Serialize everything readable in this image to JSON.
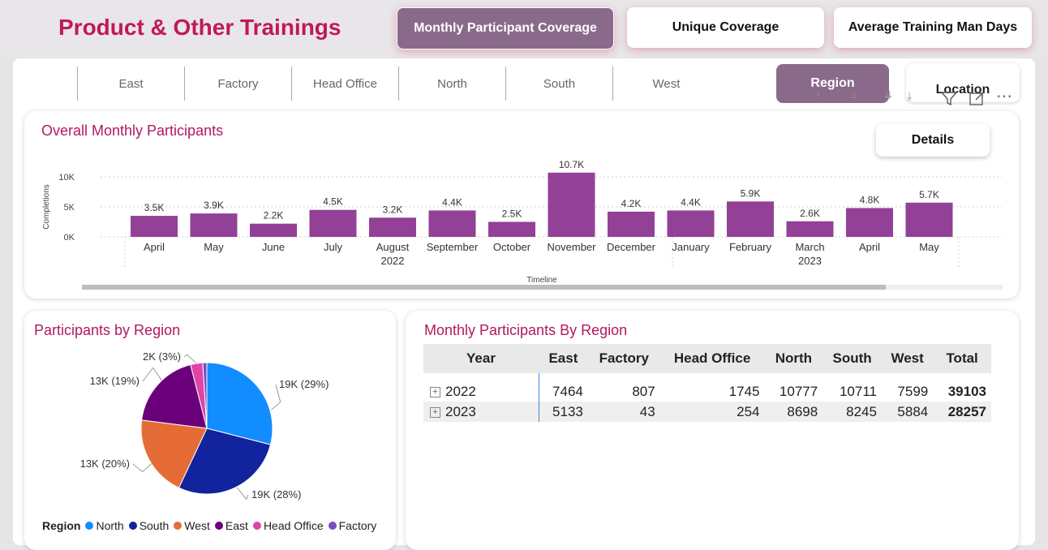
{
  "header": {
    "title": "Product & Other Trainings",
    "tabs": [
      {
        "label": "Monthly Participant Coverage",
        "active": true
      },
      {
        "label": "Unique Coverage",
        "active": false
      },
      {
        "label": "Average Training Man Days",
        "active": false
      }
    ]
  },
  "slicer": {
    "items": [
      "East",
      "Factory",
      "Head Office",
      "North",
      "South",
      "West"
    ],
    "toggle": {
      "region_label": "Region",
      "location_label": "Location",
      "active": "Region"
    }
  },
  "colors": {
    "accent": "#c2185b",
    "bar": "#924196",
    "active_button": "#8a6a8b"
  },
  "overall_chart": {
    "title": "Overall Monthly Participants",
    "details_label": "Details",
    "chart_data": {
      "type": "bar",
      "title": "Overall Monthly Participants",
      "xlabel": "Timeline",
      "ylabel": "Completions",
      "ylim": [
        0,
        10000
      ],
      "yticks": [
        "0K",
        "5K",
        "10K"
      ],
      "categories": [
        "April",
        "May",
        "June",
        "July",
        "August",
        "September",
        "October",
        "November",
        "December",
        "January",
        "February",
        "March",
        "April",
        "May"
      ],
      "years": [
        "",
        "",
        "",
        "",
        "2022",
        "",
        "",
        "",
        "",
        "",
        "",
        "2023",
        "",
        ""
      ],
      "values": [
        3500,
        3900,
        2200,
        4500,
        3200,
        4400,
        2500,
        10700,
        4200,
        4400,
        5900,
        2600,
        4800,
        5700
      ],
      "labels": [
        "3.5K",
        "3.9K",
        "2.2K",
        "4.5K",
        "3.2K",
        "4.4K",
        "2.5K",
        "10.7K",
        "4.2K",
        "4.4K",
        "5.9K",
        "2.6K",
        "4.8K",
        "5.7K"
      ],
      "grid": true
    }
  },
  "region_pie": {
    "title": "Participants by Region",
    "chart_data": {
      "type": "pie",
      "title": "Participants by Region",
      "legend_title": "Region",
      "slices": [
        {
          "name": "North",
          "value": 29,
          "label": "19K (29%)",
          "color": "#118dff"
        },
        {
          "name": "South",
          "value": 28,
          "label": "19K (28%)",
          "color": "#12239e"
        },
        {
          "name": "West",
          "value": 20,
          "label": "13K (20%)",
          "color": "#e66c37"
        },
        {
          "name": "East",
          "value": 19,
          "label": "13K (19%)",
          "color": "#6b007b"
        },
        {
          "name": "Head Office",
          "value": 3,
          "label": "2K (3%)",
          "color": "#e044a7"
        },
        {
          "name": "Factory",
          "value": 1,
          "label": "",
          "color": "#744ec2"
        }
      ]
    }
  },
  "region_table": {
    "title": "Monthly Participants By Region",
    "columns": [
      "Year",
      "East",
      "Factory",
      "Head Office",
      "North",
      "South",
      "West",
      "Total"
    ],
    "rows": [
      [
        "2022",
        "7464",
        "807",
        "1745",
        "10777",
        "10711",
        "7599",
        "39103"
      ],
      [
        "2023",
        "5133",
        "43",
        "254",
        "8698",
        "8245",
        "5884",
        "28257"
      ]
    ]
  }
}
